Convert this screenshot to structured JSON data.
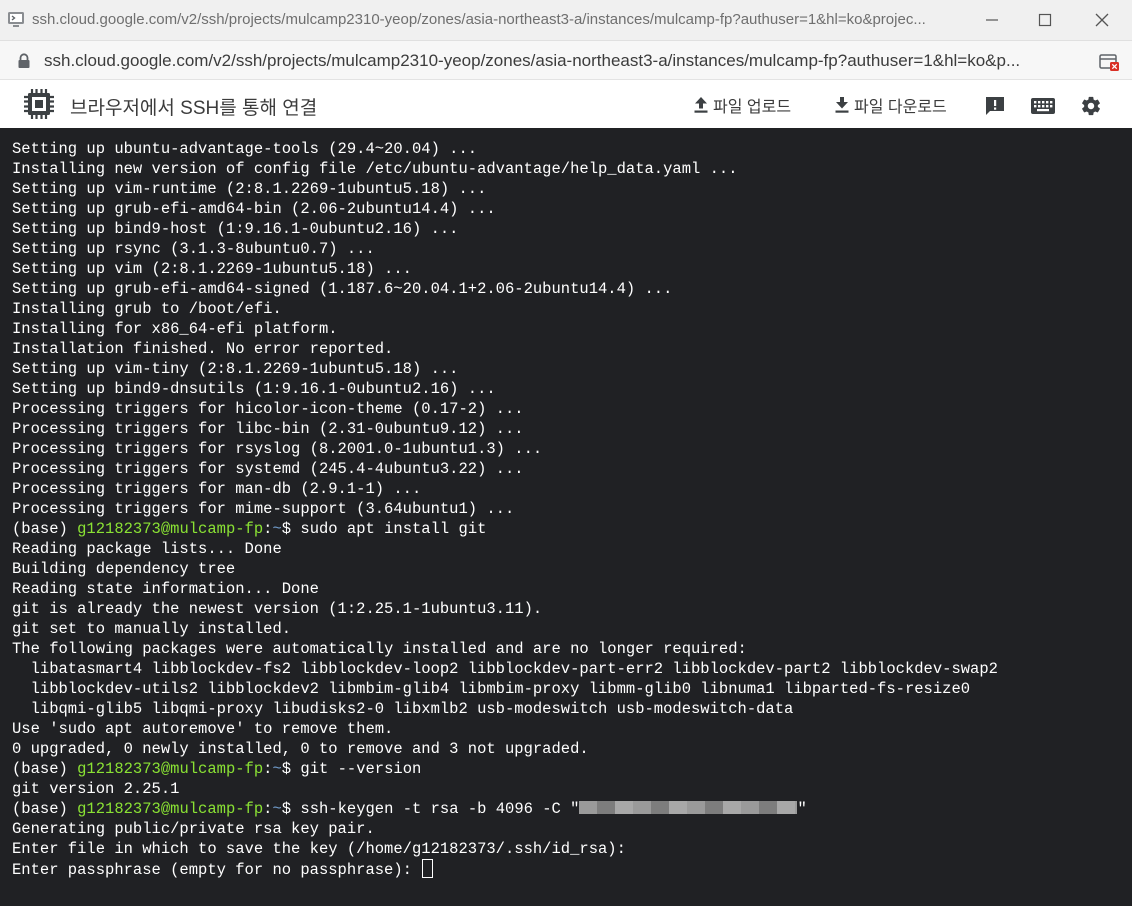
{
  "window": {
    "title": "ssh.cloud.google.com/v2/ssh/projects/mulcamp2310-yeop/zones/asia-northeast3-a/instances/mulcamp-fp?authuser=1&hl=ko&projec...",
    "url": "ssh.cloud.google.com/v2/ssh/projects/mulcamp2310-yeop/zones/asia-northeast3-a/instances/mulcamp-fp?authuser=1&hl=ko&p..."
  },
  "toolbar": {
    "title": "브라우저에서 SSH를 통해 연결",
    "upload_label": "파일 업로드",
    "download_label": "파일 다운로드"
  },
  "terminal": {
    "lines": [
      {
        "text": "Setting up ubuntu-advantage-tools (29.4~20.04) ..."
      },
      {
        "text": "Installing new version of config file /etc/ubuntu-advantage/help_data.yaml ..."
      },
      {
        "text": "Setting up vim-runtime (2:8.1.2269-1ubuntu5.18) ..."
      },
      {
        "text": "Setting up grub-efi-amd64-bin (2.06-2ubuntu14.4) ..."
      },
      {
        "text": "Setting up bind9-host (1:9.16.1-0ubuntu2.16) ..."
      },
      {
        "text": "Setting up rsync (3.1.3-8ubuntu0.7) ..."
      },
      {
        "text": "Setting up vim (2:8.1.2269-1ubuntu5.18) ..."
      },
      {
        "text": "Setting up grub-efi-amd64-signed (1.187.6~20.04.1+2.06-2ubuntu14.4) ..."
      },
      {
        "text": "Installing grub to /boot/efi."
      },
      {
        "text": "Installing for x86_64-efi platform."
      },
      {
        "text": "Installation finished. No error reported."
      },
      {
        "text": "Setting up vim-tiny (2:8.1.2269-1ubuntu5.18) ..."
      },
      {
        "text": "Setting up bind9-dnsutils (1:9.16.1-0ubuntu2.16) ..."
      },
      {
        "text": "Processing triggers for hicolor-icon-theme (0.17-2) ..."
      },
      {
        "text": "Processing triggers for libc-bin (2.31-0ubuntu9.12) ..."
      },
      {
        "text": "Processing triggers for rsyslog (8.2001.0-1ubuntu1.3) ..."
      },
      {
        "text": "Processing triggers for systemd (245.4-4ubuntu3.22) ..."
      },
      {
        "text": "Processing triggers for man-db (2.9.1-1) ..."
      },
      {
        "text": "Processing triggers for mime-support (3.64ubuntu1) ..."
      },
      {
        "prompt": true,
        "env": "(base) ",
        "user": "g12182373@mulcamp-fp",
        "sep": ":",
        "path": "~",
        "sign": "$ ",
        "cmd": "sudo apt install git"
      },
      {
        "text": "Reading package lists... Done"
      },
      {
        "text": "Building dependency tree"
      },
      {
        "text": "Reading state information... Done"
      },
      {
        "text": "git is already the newest version (1:2.25.1-1ubuntu3.11)."
      },
      {
        "text": "git set to manually installed."
      },
      {
        "text": "The following packages were automatically installed and are no longer required:"
      },
      {
        "text": "  libatasmart4 libblockdev-fs2 libblockdev-loop2 libblockdev-part-err2 libblockdev-part2 libblockdev-swap2"
      },
      {
        "text": "  libblockdev-utils2 libblockdev2 libmbim-glib4 libmbim-proxy libmm-glib0 libnuma1 libparted-fs-resize0"
      },
      {
        "text": "  libqmi-glib5 libqmi-proxy libudisks2-0 libxmlb2 usb-modeswitch usb-modeswitch-data"
      },
      {
        "text": "Use 'sudo apt autoremove' to remove them."
      },
      {
        "text": "0 upgraded, 0 newly installed, 0 to remove and 3 not upgraded."
      },
      {
        "prompt": true,
        "env": "(base) ",
        "user": "g12182373@mulcamp-fp",
        "sep": ":",
        "path": "~",
        "sign": "$ ",
        "cmd": "git --version"
      },
      {
        "text": "git version 2.25.1"
      },
      {
        "prompt": true,
        "env": "(base) ",
        "user": "g12182373@mulcamp-fp",
        "sep": ":",
        "path": "~",
        "sign": "$ ",
        "cmd": "ssh-keygen -t rsa -b 4096 -C \"",
        "redacted": true,
        "cmd_after": "\""
      },
      {
        "text": "Generating public/private rsa key pair."
      },
      {
        "text": "Enter file in which to save the key (/home/g12182373/.ssh/id_rsa):"
      },
      {
        "text": "Enter passphrase (empty for no passphrase): ",
        "cursor": true
      }
    ]
  }
}
